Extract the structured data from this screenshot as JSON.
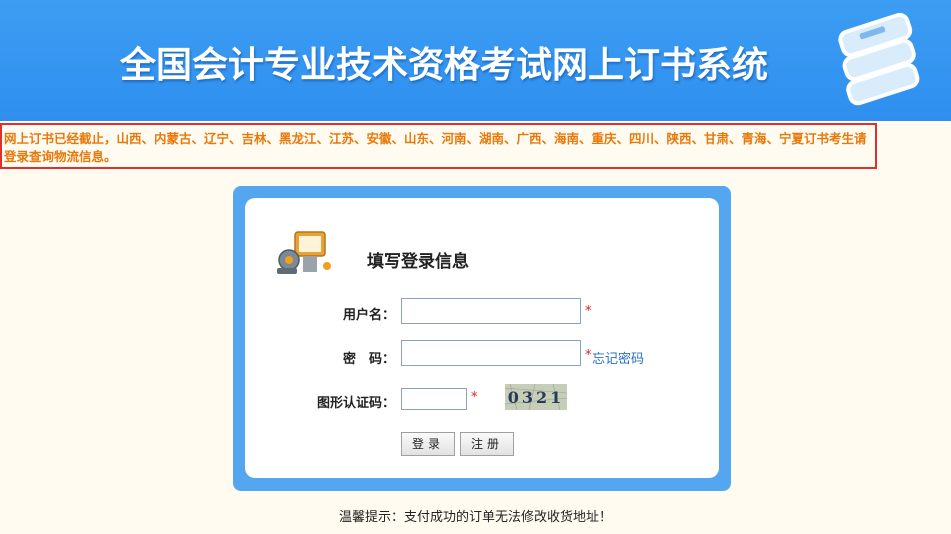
{
  "header": {
    "title": "全国会计专业技术资格考试网上订书系统"
  },
  "notice": {
    "text": "网上订书已经截止，山西、内蒙古、辽宁、吉林、黑龙江、江苏、安徽、山东、河南、湖南、广西、海南、重庆、四川、陕西、甘肃、青海、宁夏订书考生请登录查询物流信息。"
  },
  "login": {
    "title": "填写登录信息",
    "username_label": "用户名：",
    "username_value": "",
    "password_label": "密　码：",
    "password_value": "",
    "captcha_label": "图形认证码：",
    "captcha_value": "",
    "required_mark": "*",
    "forgot_label": "忘记密码",
    "captcha_text": "0321",
    "login_button": "登录",
    "register_button": "注册"
  },
  "tip": {
    "text": "温馨提示：支付成功的订单无法修改收货地址！"
  },
  "colors": {
    "header_blue": "#3c9df2",
    "panel_blue": "#54a6f0",
    "notice_orange": "#e8780a",
    "notice_border": "#e0302e",
    "required_red": "#e02020",
    "link_blue": "#2a6fc6"
  },
  "icons": [
    "books-icon",
    "login-key-icon",
    "captcha-image"
  ]
}
